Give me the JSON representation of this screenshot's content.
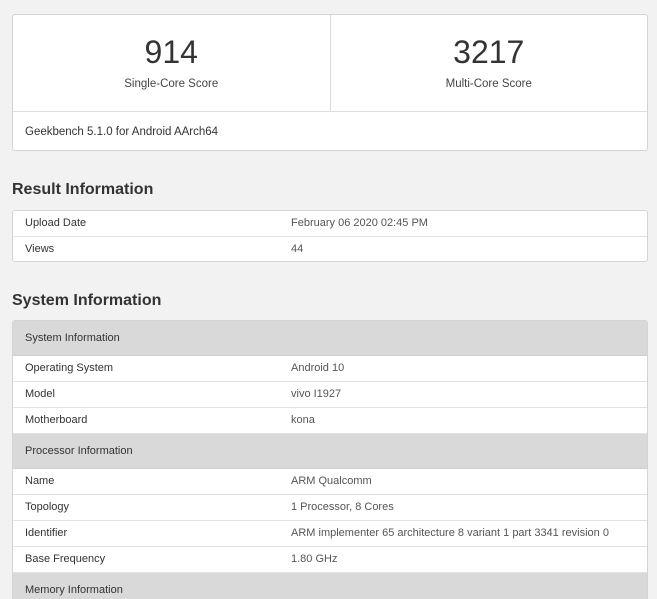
{
  "scores": {
    "single_core": {
      "value": "914",
      "label": "Single-Core Score"
    },
    "multi_core": {
      "value": "3217",
      "label": "Multi-Core Score"
    },
    "version": "Geekbench 5.1.0 for Android AArch64"
  },
  "result_information": {
    "heading": "Result Information",
    "rows": [
      {
        "name": "Upload Date",
        "value": "February 06 2020 02:45 PM"
      },
      {
        "name": "Views",
        "value": "44"
      }
    ]
  },
  "system_information": {
    "heading": "System Information",
    "groups": [
      {
        "title": "System Information",
        "rows": [
          {
            "name": "Operating System",
            "value": "Android 10"
          },
          {
            "name": "Model",
            "value": "vivo I1927"
          },
          {
            "name": "Motherboard",
            "value": "kona"
          }
        ]
      },
      {
        "title": "Processor Information",
        "rows": [
          {
            "name": "Name",
            "value": "ARM Qualcomm"
          },
          {
            "name": "Topology",
            "value": "1 Processor, 8 Cores"
          },
          {
            "name": "Identifier",
            "value": "ARM implementer 65 architecture 8 variant 1 part 3341 revision 0"
          },
          {
            "name": "Base Frequency",
            "value": "1.80 GHz"
          }
        ]
      },
      {
        "title": "Memory Information",
        "rows": []
      }
    ]
  }
}
